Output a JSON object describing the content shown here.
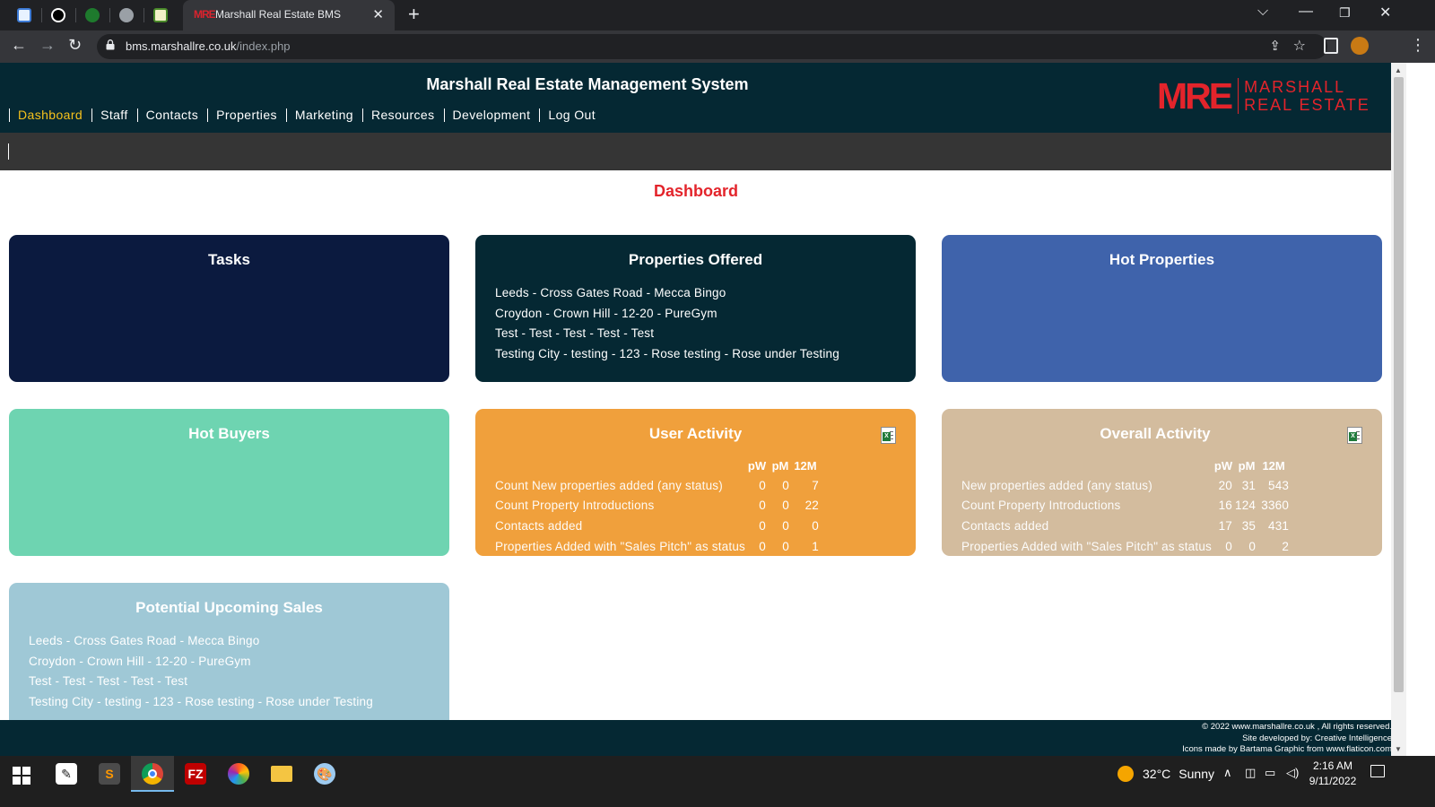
{
  "browser": {
    "tab_title": "Marshall Real Estate BMS",
    "tab_favicon_text": "MRE",
    "url_domain": "bms.marshallre.co.uk",
    "url_path": "/index.php"
  },
  "site": {
    "title": "Marshall Real Estate Management System",
    "logo_mark": "MRE",
    "logo_line1": "MARSHALL",
    "logo_line2": "REAL ESTATE",
    "accent_red": "#e3242b",
    "header_bg": "#052833",
    "active_nav_color": "#f7c21c",
    "nav": [
      {
        "label": "Dashboard",
        "active": true
      },
      {
        "label": "Staff"
      },
      {
        "label": "Contacts"
      },
      {
        "label": "Properties"
      },
      {
        "label": "Marketing"
      },
      {
        "label": "Resources"
      },
      {
        "label": "Development"
      },
      {
        "label": "Log Out"
      }
    ]
  },
  "page": {
    "title": "Dashboard"
  },
  "cards": {
    "tasks": {
      "title": "Tasks",
      "color": "#0b1a3f"
    },
    "properties_offered": {
      "title": "Properties Offered",
      "color": "#052833",
      "items": [
        "Leeds - Cross Gates Road - Mecca Bingo",
        "Croydon - Crown Hill - 12-20 - PureGym",
        "Test - Test - Test - Test - Test",
        "Testing City - testing - 123 - Rose testing - Rose under Testing"
      ]
    },
    "hot_properties": {
      "title": "Hot Properties",
      "color": "#3f63ab"
    },
    "hot_buyers": {
      "title": "Hot Buyers",
      "color": "#6ed4b1"
    },
    "user_activity": {
      "title": "User Activity",
      "color": "#f0a03c",
      "export_icon": "excel-export-icon",
      "columns": [
        "pW",
        "pM",
        "12M"
      ],
      "rows": [
        {
          "label": "Count New properties added (any status)",
          "pw": "0",
          "pm": "0",
          "m12": "7"
        },
        {
          "label": "Count Property Introductions",
          "pw": "0",
          "pm": "0",
          "m12": "22"
        },
        {
          "label": "Contacts added",
          "pw": "0",
          "pm": "0",
          "m12": "0"
        },
        {
          "label": "Properties Added with \"Sales Pitch\" as status",
          "pw": "0",
          "pm": "0",
          "m12": "1"
        }
      ]
    },
    "overall_activity": {
      "title": "Overall Activity",
      "color": "#d3bc9e",
      "export_icon": "excel-export-icon",
      "columns": [
        "pW",
        "pM",
        "12M"
      ],
      "rows": [
        {
          "label": "New properties added (any status)",
          "pw": "20",
          "pm": "31",
          "m12": "543"
        },
        {
          "label": "Count Property Introductions",
          "pw": "16",
          "pm": "124",
          "m12": "3360"
        },
        {
          "label": "Contacts added",
          "pw": "17",
          "pm": "35",
          "m12": "431"
        },
        {
          "label": "Properties Added with \"Sales Pitch\" as status",
          "pw": "0",
          "pm": "0",
          "m12": "2"
        }
      ]
    },
    "potential_sales": {
      "title": "Potential Upcoming Sales",
      "color": "#9fc8d6",
      "items": [
        "Leeds - Cross Gates Road - Mecca Bingo",
        "Croydon - Crown Hill - 12-20 - PureGym",
        "Test - Test - Test - Test - Test",
        "Testing City - testing - 123 - Rose testing - Rose under Testing"
      ]
    }
  },
  "footer": {
    "line1": "© 2022 www.marshallre.co.uk , All rights reserved.",
    "line2": "Site developed by: Creative Intelligence",
    "line3": "Icons made by Bartama Graphic from www.flaticon.com"
  },
  "taskbar": {
    "weather_temp": "32°C",
    "weather_text": "Sunny",
    "time": "2:16 AM",
    "date": "9/11/2022"
  }
}
